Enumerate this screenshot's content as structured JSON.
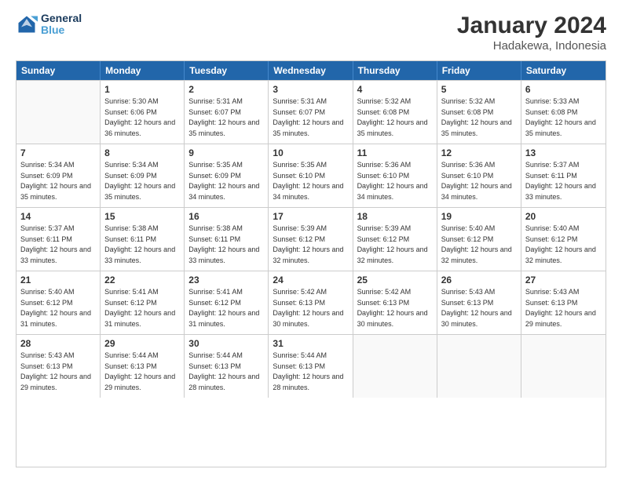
{
  "logo": {
    "line1": "General",
    "line2": "Blue"
  },
  "title": "January 2024",
  "subtitle": "Hadakewa, Indonesia",
  "headers": [
    "Sunday",
    "Monday",
    "Tuesday",
    "Wednesday",
    "Thursday",
    "Friday",
    "Saturday"
  ],
  "rows": [
    [
      {
        "day": "",
        "empty": true
      },
      {
        "day": "1",
        "sunrise": "5:30 AM",
        "sunset": "6:06 PM",
        "daylight": "12 hours and 36 minutes."
      },
      {
        "day": "2",
        "sunrise": "5:31 AM",
        "sunset": "6:07 PM",
        "daylight": "12 hours and 35 minutes."
      },
      {
        "day": "3",
        "sunrise": "5:31 AM",
        "sunset": "6:07 PM",
        "daylight": "12 hours and 35 minutes."
      },
      {
        "day": "4",
        "sunrise": "5:32 AM",
        "sunset": "6:08 PM",
        "daylight": "12 hours and 35 minutes."
      },
      {
        "day": "5",
        "sunrise": "5:32 AM",
        "sunset": "6:08 PM",
        "daylight": "12 hours and 35 minutes."
      },
      {
        "day": "6",
        "sunrise": "5:33 AM",
        "sunset": "6:08 PM",
        "daylight": "12 hours and 35 minutes."
      }
    ],
    [
      {
        "day": "7",
        "sunrise": "5:34 AM",
        "sunset": "6:09 PM",
        "daylight": "12 hours and 35 minutes."
      },
      {
        "day": "8",
        "sunrise": "5:34 AM",
        "sunset": "6:09 PM",
        "daylight": "12 hours and 35 minutes."
      },
      {
        "day": "9",
        "sunrise": "5:35 AM",
        "sunset": "6:09 PM",
        "daylight": "12 hours and 34 minutes."
      },
      {
        "day": "10",
        "sunrise": "5:35 AM",
        "sunset": "6:10 PM",
        "daylight": "12 hours and 34 minutes."
      },
      {
        "day": "11",
        "sunrise": "5:36 AM",
        "sunset": "6:10 PM",
        "daylight": "12 hours and 34 minutes."
      },
      {
        "day": "12",
        "sunrise": "5:36 AM",
        "sunset": "6:10 PM",
        "daylight": "12 hours and 34 minutes."
      },
      {
        "day": "13",
        "sunrise": "5:37 AM",
        "sunset": "6:11 PM",
        "daylight": "12 hours and 33 minutes."
      }
    ],
    [
      {
        "day": "14",
        "sunrise": "5:37 AM",
        "sunset": "6:11 PM",
        "daylight": "12 hours and 33 minutes."
      },
      {
        "day": "15",
        "sunrise": "5:38 AM",
        "sunset": "6:11 PM",
        "daylight": "12 hours and 33 minutes."
      },
      {
        "day": "16",
        "sunrise": "5:38 AM",
        "sunset": "6:11 PM",
        "daylight": "12 hours and 33 minutes."
      },
      {
        "day": "17",
        "sunrise": "5:39 AM",
        "sunset": "6:12 PM",
        "daylight": "12 hours and 32 minutes."
      },
      {
        "day": "18",
        "sunrise": "5:39 AM",
        "sunset": "6:12 PM",
        "daylight": "12 hours and 32 minutes."
      },
      {
        "day": "19",
        "sunrise": "5:40 AM",
        "sunset": "6:12 PM",
        "daylight": "12 hours and 32 minutes."
      },
      {
        "day": "20",
        "sunrise": "5:40 AM",
        "sunset": "6:12 PM",
        "daylight": "12 hours and 32 minutes."
      }
    ],
    [
      {
        "day": "21",
        "sunrise": "5:40 AM",
        "sunset": "6:12 PM",
        "daylight": "12 hours and 31 minutes."
      },
      {
        "day": "22",
        "sunrise": "5:41 AM",
        "sunset": "6:12 PM",
        "daylight": "12 hours and 31 minutes."
      },
      {
        "day": "23",
        "sunrise": "5:41 AM",
        "sunset": "6:12 PM",
        "daylight": "12 hours and 31 minutes."
      },
      {
        "day": "24",
        "sunrise": "5:42 AM",
        "sunset": "6:13 PM",
        "daylight": "12 hours and 30 minutes."
      },
      {
        "day": "25",
        "sunrise": "5:42 AM",
        "sunset": "6:13 PM",
        "daylight": "12 hours and 30 minutes."
      },
      {
        "day": "26",
        "sunrise": "5:43 AM",
        "sunset": "6:13 PM",
        "daylight": "12 hours and 30 minutes."
      },
      {
        "day": "27",
        "sunrise": "5:43 AM",
        "sunset": "6:13 PM",
        "daylight": "12 hours and 29 minutes."
      }
    ],
    [
      {
        "day": "28",
        "sunrise": "5:43 AM",
        "sunset": "6:13 PM",
        "daylight": "12 hours and 29 minutes."
      },
      {
        "day": "29",
        "sunrise": "5:44 AM",
        "sunset": "6:13 PM",
        "daylight": "12 hours and 29 minutes."
      },
      {
        "day": "30",
        "sunrise": "5:44 AM",
        "sunset": "6:13 PM",
        "daylight": "12 hours and 28 minutes."
      },
      {
        "day": "31",
        "sunrise": "5:44 AM",
        "sunset": "6:13 PM",
        "daylight": "12 hours and 28 minutes."
      },
      {
        "day": "",
        "empty": true
      },
      {
        "day": "",
        "empty": true
      },
      {
        "day": "",
        "empty": true
      }
    ]
  ]
}
